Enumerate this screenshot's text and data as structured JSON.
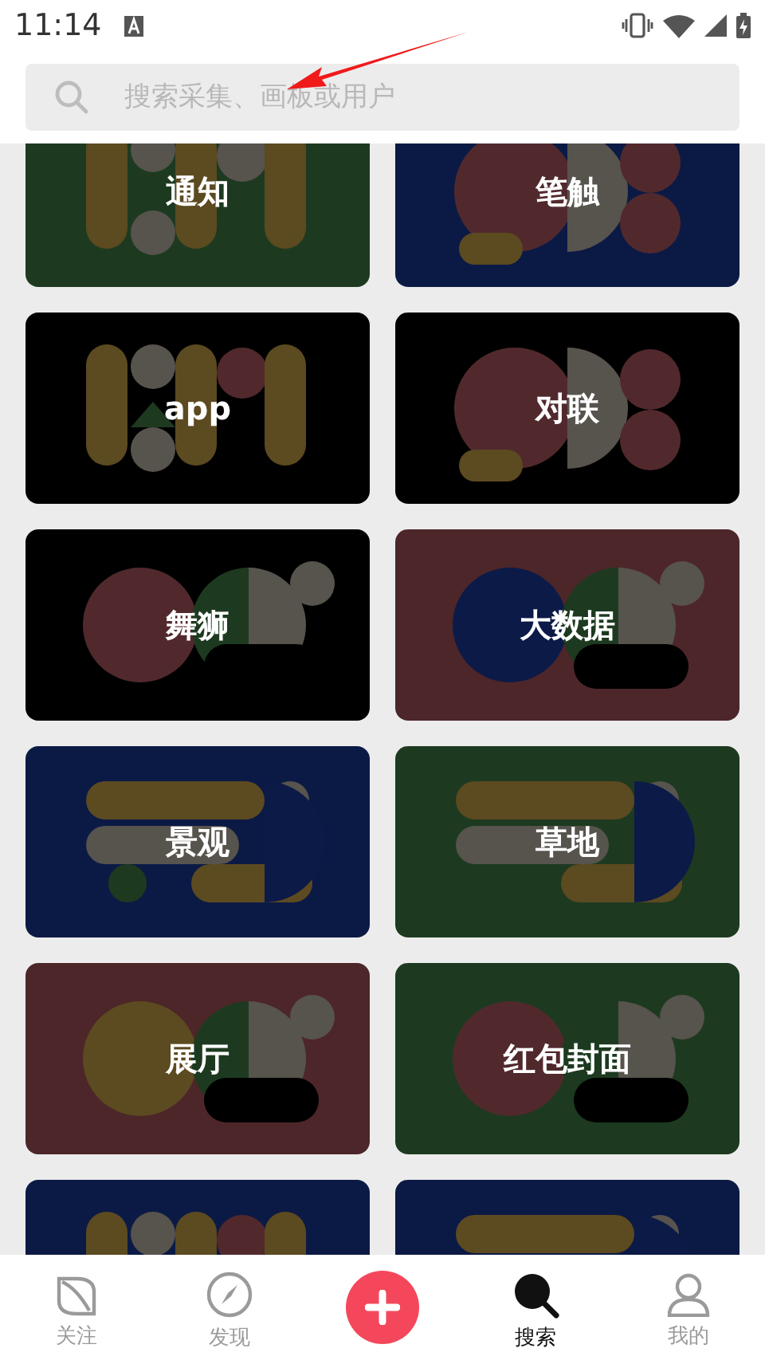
{
  "status_bar": {
    "time": "11:14"
  },
  "search": {
    "placeholder": "搜索采集、画板或用户"
  },
  "annotation": {
    "kind": "arrow",
    "color": "#f01a1a"
  },
  "boards": [
    {
      "label": "通知",
      "color": "#1d3a20"
    },
    {
      "label": "笔触",
      "color": "#0b1a45"
    },
    {
      "label": "app",
      "color": "#000000"
    },
    {
      "label": "对联",
      "color": "#000000"
    },
    {
      "label": "舞狮",
      "color": "#000000"
    },
    {
      "label": "大数据",
      "color": "#4d2629"
    },
    {
      "label": "景观",
      "color": "#0b1a45"
    },
    {
      "label": "草地",
      "color": "#1d3a20"
    },
    {
      "label": "展厅",
      "color": "#4d2629"
    },
    {
      "label": "红包封面",
      "color": "#1d3a20"
    },
    {
      "color": "#0b1a45"
    },
    {
      "color": "#0b1a45"
    }
  ],
  "nav": [
    {
      "kind": "leaf",
      "label": "关注",
      "selected": false
    },
    {
      "kind": "compass",
      "label": "发现",
      "selected": false
    },
    {
      "kind": "add"
    },
    {
      "kind": "search",
      "label": "搜索",
      "selected": true
    },
    {
      "kind": "person",
      "label": "我的",
      "selected": false
    }
  ]
}
